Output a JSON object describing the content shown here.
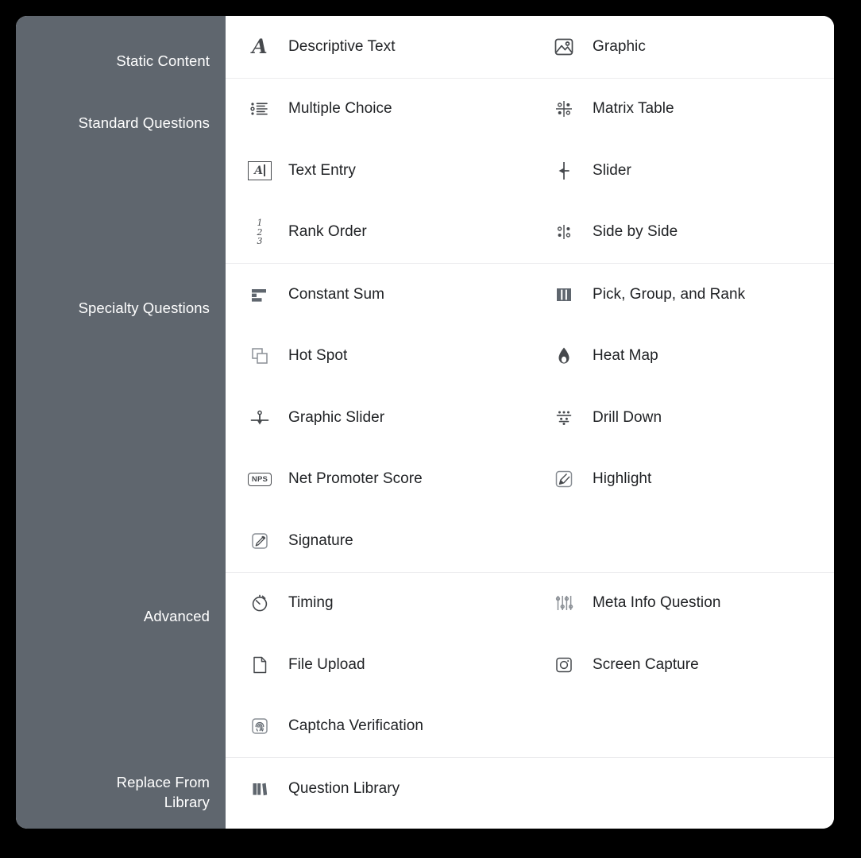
{
  "panel": {
    "sidebar_bg": "#5f666e",
    "content_bg": "#ffffff",
    "divider_color": "#ececee",
    "label_color": "#ffffff",
    "item_text_color": "#1f2124",
    "icon_color": "#46494d"
  },
  "sidebar": {
    "labels": [
      {
        "text": "Static Content"
      },
      {
        "text": "Standard Questions"
      },
      {
        "text": "Specialty Questions"
      },
      {
        "text": "Advanced"
      },
      {
        "text": "Replace From\nLibrary"
      }
    ]
  },
  "groups": [
    {
      "key": "static-content",
      "title": "Static Content",
      "items": [
        {
          "label": "Descriptive Text",
          "icon": "serif-a-icon"
        },
        {
          "label": "Graphic",
          "icon": "image-icon"
        }
      ]
    },
    {
      "key": "standard-questions",
      "title": "Standard Questions",
      "items": [
        {
          "label": "Multiple Choice",
          "icon": "bulleted-list-icon"
        },
        {
          "label": "Matrix Table",
          "icon": "matrix-grid-icon"
        },
        {
          "label": "Text Entry",
          "icon": "text-field-icon"
        },
        {
          "label": "Slider",
          "icon": "slider-handle-icon"
        },
        {
          "label": "Rank Order",
          "icon": "numbered-list-icon"
        },
        {
          "label": "Side by Side",
          "icon": "two-column-dots-icon"
        }
      ]
    },
    {
      "key": "specialty-questions",
      "title": "Specialty Questions",
      "items": [
        {
          "label": "Constant Sum",
          "icon": "bar-chart-icon"
        },
        {
          "label": "Pick, Group, and Rank",
          "icon": "vertical-bars-icon"
        },
        {
          "label": "Hot Spot",
          "icon": "overlapping-squares-icon"
        },
        {
          "label": "Heat Map",
          "icon": "flame-icon"
        },
        {
          "label": "Graphic Slider",
          "icon": "graphic-slider-icon"
        },
        {
          "label": "Drill Down",
          "icon": "funnel-dots-icon"
        },
        {
          "label": "Net Promoter Score",
          "icon": "nps-badge-icon"
        },
        {
          "label": "Highlight",
          "icon": "highlighter-icon"
        },
        {
          "label": "Signature",
          "icon": "signature-pen-icon"
        },
        {
          "label": "",
          "icon": ""
        }
      ]
    },
    {
      "key": "advanced",
      "title": "Advanced",
      "items": [
        {
          "label": "Timing",
          "icon": "stopwatch-icon"
        },
        {
          "label": "Meta Info Question",
          "icon": "sliders-settings-icon"
        },
        {
          "label": "File Upload",
          "icon": "document-icon"
        },
        {
          "label": "Screen Capture",
          "icon": "camera-icon"
        },
        {
          "label": "Captcha Verification",
          "icon": "fingerprint-icon"
        },
        {
          "label": "",
          "icon": ""
        }
      ]
    },
    {
      "key": "replace-from-library",
      "title": "Replace From Library",
      "items": [
        {
          "label": "Question Library",
          "icon": "books-icon"
        },
        {
          "label": "",
          "icon": ""
        }
      ]
    }
  ]
}
